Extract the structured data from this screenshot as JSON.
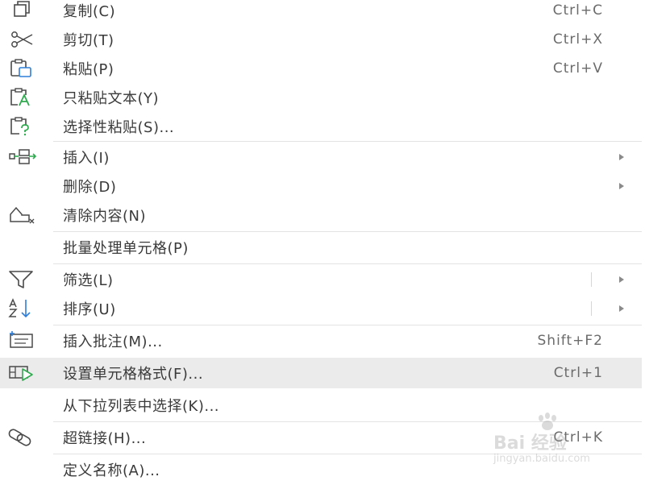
{
  "menu": {
    "items": [
      {
        "label": "复制(C)",
        "shortcut": "Ctrl+C",
        "icon": "copy-icon"
      },
      {
        "label": "剪切(T)",
        "shortcut": "Ctrl+X",
        "icon": "scissors-icon"
      },
      {
        "label": "粘贴(P)",
        "shortcut": "Ctrl+V",
        "icon": "paste-icon"
      },
      {
        "label": "只粘贴文本(Y)",
        "icon": "paste-text-icon"
      },
      {
        "label": "选择性粘贴(S)...",
        "icon": "paste-special-icon"
      },
      {
        "label": "插入(I)",
        "icon": "insert-icon",
        "submenu": true
      },
      {
        "label": "删除(D)",
        "submenu": true
      },
      {
        "label": "清除内容(N)",
        "icon": "eraser-icon"
      },
      {
        "label": "批量处理单元格(P)"
      },
      {
        "label": "筛选(L)",
        "icon": "filter-icon",
        "submenu": true
      },
      {
        "label": "排序(U)",
        "icon": "sort-az-icon",
        "submenu": true
      },
      {
        "label": "插入批注(M)...",
        "shortcut": "Shift+F2",
        "icon": "comment-icon"
      },
      {
        "label": "设置单元格格式(F)...",
        "shortcut": "Ctrl+1",
        "icon": "format-cells-icon",
        "highlighted": true
      },
      {
        "label": "从下拉列表中选择(K)..."
      },
      {
        "label": "超链接(H)...",
        "shortcut": "Ctrl+K",
        "icon": "link-icon"
      },
      {
        "label": "定义名称(A)..."
      }
    ]
  },
  "watermark": {
    "brand": "Bai 经验",
    "url": "jingyan.baidu.com"
  },
  "colors": {
    "icon_stroke": "#4a4a4a",
    "icon_accent": "#2f7fd8",
    "icon_green": "#2faa4f",
    "highlight_bg": "#ebebeb",
    "separator": "#e3e3e3"
  }
}
